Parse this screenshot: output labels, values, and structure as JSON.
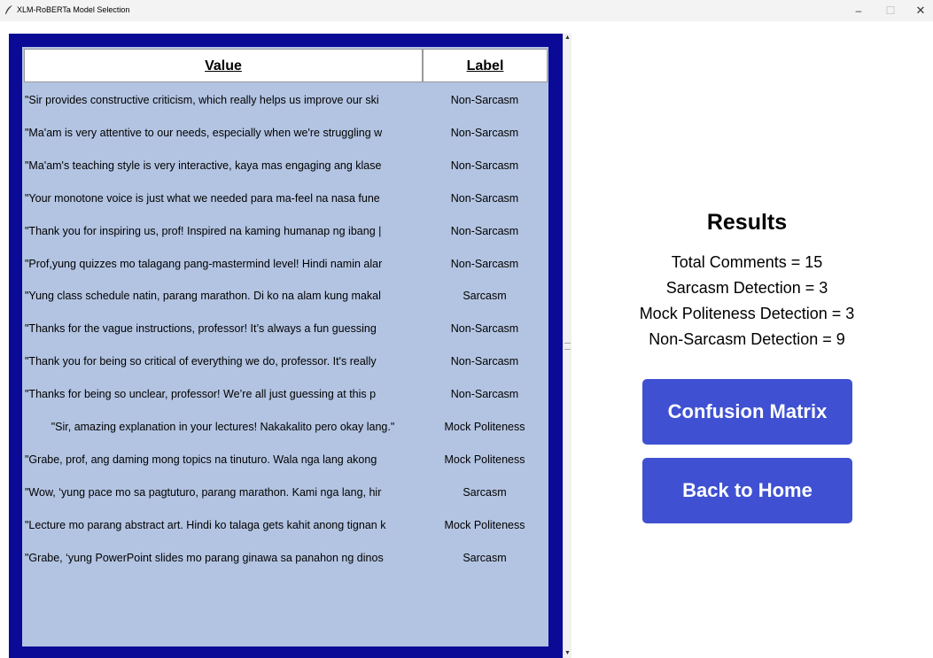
{
  "window": {
    "title": "XLM-RoBERTa Model Selection",
    "icons": [
      "feather-icon",
      "minimize-icon",
      "maximize-icon",
      "close-icon"
    ],
    "minimize_glyph": "–",
    "maximize_glyph": "☐",
    "close_glyph": "✕"
  },
  "table": {
    "columns": [
      "Value",
      "Label"
    ],
    "rows": [
      {
        "value": "\"Sir provides constructive criticism, which really helps us improve our ski",
        "label": "Non-Sarcasm"
      },
      {
        "value": "\"Ma'am is very attentive to our needs, especially when we're struggling w",
        "label": "Non-Sarcasm"
      },
      {
        "value": "\"Ma'am's teaching style is very interactive, kaya mas engaging ang klase",
        "label": "Non-Sarcasm"
      },
      {
        "value": "\"Your monotone voice is just what we needed para ma-feel na nasa fune",
        "label": "Non-Sarcasm"
      },
      {
        "value": "\"Thank you for inspiring us, prof! Inspired na kaming humanap ng ibang |",
        "label": "Non-Sarcasm"
      },
      {
        "value": "\"Prof,yung quizzes mo talagang pang-mastermind level! Hindi namin alar",
        "label": "Non-Sarcasm"
      },
      {
        "value": "\"Yung class schedule natin, parang marathon.  Di ko na alam kung makal",
        "label": "Sarcasm"
      },
      {
        "value": "\"Thanks for the vague instructions, professor! It’s always a fun guessing",
        "label": "Non-Sarcasm"
      },
      {
        "value": "\"Thank you for being so critical of everything we do, professor. It's really",
        "label": "Non-Sarcasm"
      },
      {
        "value": "\"Thanks for being so unclear, professor! We’re all just guessing at this p",
        "label": "Non-Sarcasm"
      },
      {
        "value": "\"Sir, amazing explanation in your lectures! Nakakalito pero okay lang.\"",
        "label": "Mock Politeness"
      },
      {
        "value": "\"Grabe, prof, ang daming mong topics na tinuturo. Wala nga lang akong",
        "label": "Mock Politeness"
      },
      {
        "value": "\"Wow, ‘yung pace mo sa pagtuturo, parang marathon. Kami nga lang, hir",
        "label": "Sarcasm"
      },
      {
        "value": "\"Lecture mo parang abstract art. Hindi ko talaga gets kahit anong tignan k",
        "label": "Mock Politeness"
      },
      {
        "value": "\"Grabe, ‘yung PowerPoint slides mo parang ginawa sa panahon ng dinos",
        "label": "Sarcasm"
      }
    ]
  },
  "results": {
    "title": "Results",
    "total_comments": "Total Comments = 15",
    "sarcasm": "Sarcasm Detection = 3",
    "mock_politeness": "Mock Politeness Detection = 3",
    "non_sarcasm": "Non-Sarcasm Detection = 9"
  },
  "buttons": {
    "confusion_matrix": "Confusion Matrix",
    "back_home": "Back to Home"
  },
  "colors": {
    "panel_border": "#0a0a96",
    "panel_bg": "#b3c4e2",
    "button_bg": "#3f51d2",
    "button_text": "#ffffff"
  }
}
